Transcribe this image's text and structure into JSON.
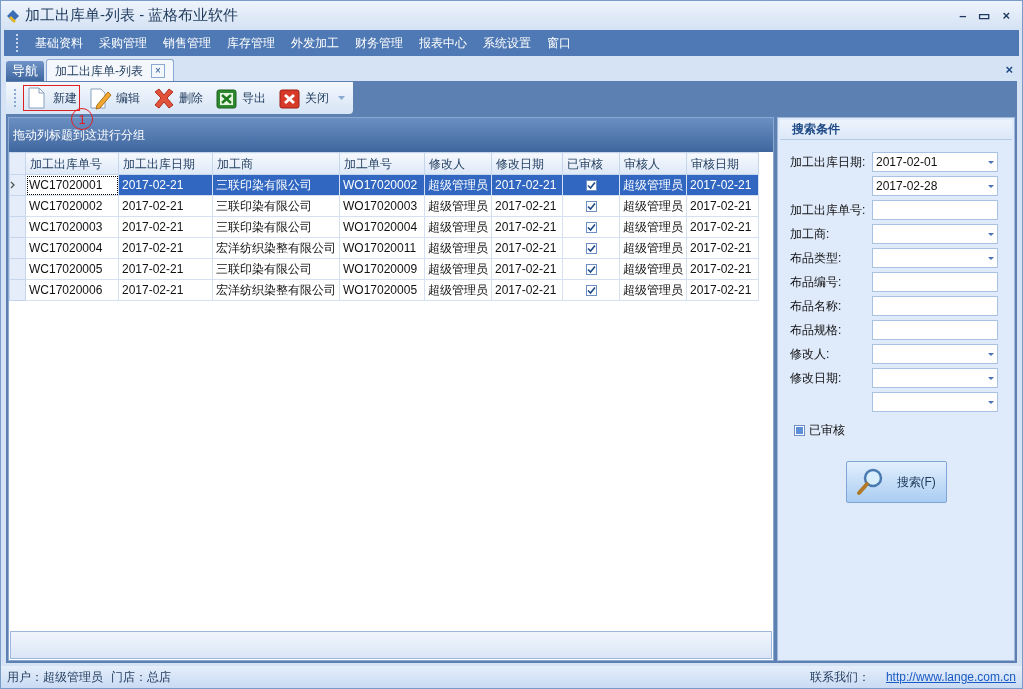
{
  "window": {
    "title": "加工出库单-列表 - 蓝格布业软件",
    "controls": [
      "–",
      "▭",
      "×"
    ]
  },
  "menu": [
    "基础资料",
    "采购管理",
    "销售管理",
    "库存管理",
    "外发加工",
    "财务管理",
    "报表中心",
    "系统设置",
    "窗口"
  ],
  "tabs": [
    {
      "label": "导航",
      "selected": false,
      "closable": false
    },
    {
      "label": "加工出库单-列表",
      "selected": true,
      "closable": true
    }
  ],
  "tab_strip_close": "×",
  "toolbar": [
    {
      "kind": "new",
      "label": "新建",
      "highlighted": true
    },
    {
      "kind": "edit",
      "label": "编辑",
      "highlighted": false
    },
    {
      "kind": "delete",
      "label": "删除",
      "highlighted": false
    },
    {
      "kind": "export",
      "label": "导出",
      "highlighted": false
    },
    {
      "kind": "close",
      "label": "关闭",
      "highlighted": false
    }
  ],
  "annotation": "1",
  "group_panel": "拖动列标题到这进行分组",
  "table": {
    "columns": [
      "加工出库单号",
      "加工出库日期",
      "加工商",
      "加工单号",
      "修改人",
      "修改日期",
      "已审核",
      "审核人",
      "审核日期"
    ],
    "rows": [
      {
        "selected": true,
        "cells": [
          "WC17020001",
          "2017-02-21",
          "三联印染有限公司",
          "WO17020002",
          "超级管理员",
          "2017-02-21",
          {
            "checked": true
          },
          "超级管理员",
          "2017-02-21"
        ]
      },
      {
        "selected": false,
        "cells": [
          "WC17020002",
          "2017-02-21",
          "三联印染有限公司",
          "WO17020003",
          "超级管理员",
          "2017-02-21",
          {
            "checked": true
          },
          "超级管理员",
          "2017-02-21"
        ]
      },
      {
        "selected": false,
        "cells": [
          "WC17020003",
          "2017-02-21",
          "三联印染有限公司",
          "WO17020004",
          "超级管理员",
          "2017-02-21",
          {
            "checked": true
          },
          "超级管理员",
          "2017-02-21"
        ]
      },
      {
        "selected": false,
        "cells": [
          "WC17020004",
          "2017-02-21",
          "宏洋纺织染整有限公司",
          "WO17020011",
          "超级管理员",
          "2017-02-21",
          {
            "checked": true
          },
          "超级管理员",
          "2017-02-21"
        ]
      },
      {
        "selected": false,
        "cells": [
          "WC17020005",
          "2017-02-21",
          "三联印染有限公司",
          "WO17020009",
          "超级管理员",
          "2017-02-21",
          {
            "checked": true
          },
          "超级管理员",
          "2017-02-21"
        ]
      },
      {
        "selected": false,
        "cells": [
          "WC17020006",
          "2017-02-21",
          "宏洋纺织染整有限公司",
          "WO17020005",
          "超级管理员",
          "2017-02-21",
          {
            "checked": true
          },
          "超级管理员",
          "2017-02-21"
        ]
      }
    ]
  },
  "search_panel": {
    "title": "搜索条件",
    "fields": [
      {
        "label": "加工出库日期:",
        "kind": "dropdown",
        "value": "2017-02-01"
      },
      {
        "kind": "dropdown",
        "value": "2017-02-28"
      },
      {
        "label": "加工出库单号:",
        "kind": "text"
      },
      {
        "label": "加工商:",
        "kind": "dropdown"
      },
      {
        "label": "布品类型:",
        "kind": "dropdown"
      },
      {
        "label": "布品编号:",
        "kind": "text"
      },
      {
        "label": "布品名称:",
        "kind": "text"
      },
      {
        "label": "布品规格:",
        "kind": "text"
      },
      {
        "label": "修改人:",
        "kind": "dropdown"
      },
      {
        "label": "修改日期:",
        "kind": "dropdown"
      },
      {
        "kind": "dropdown"
      }
    ],
    "checkbox": {
      "label": "已审核",
      "indeterminate": true
    },
    "button": "搜索(F)"
  },
  "status_bar": {
    "user": "用户：超级管理员",
    "store": "门店：总店",
    "contact_label": "联系我们：",
    "link": "http://www.lange.com.cn"
  }
}
